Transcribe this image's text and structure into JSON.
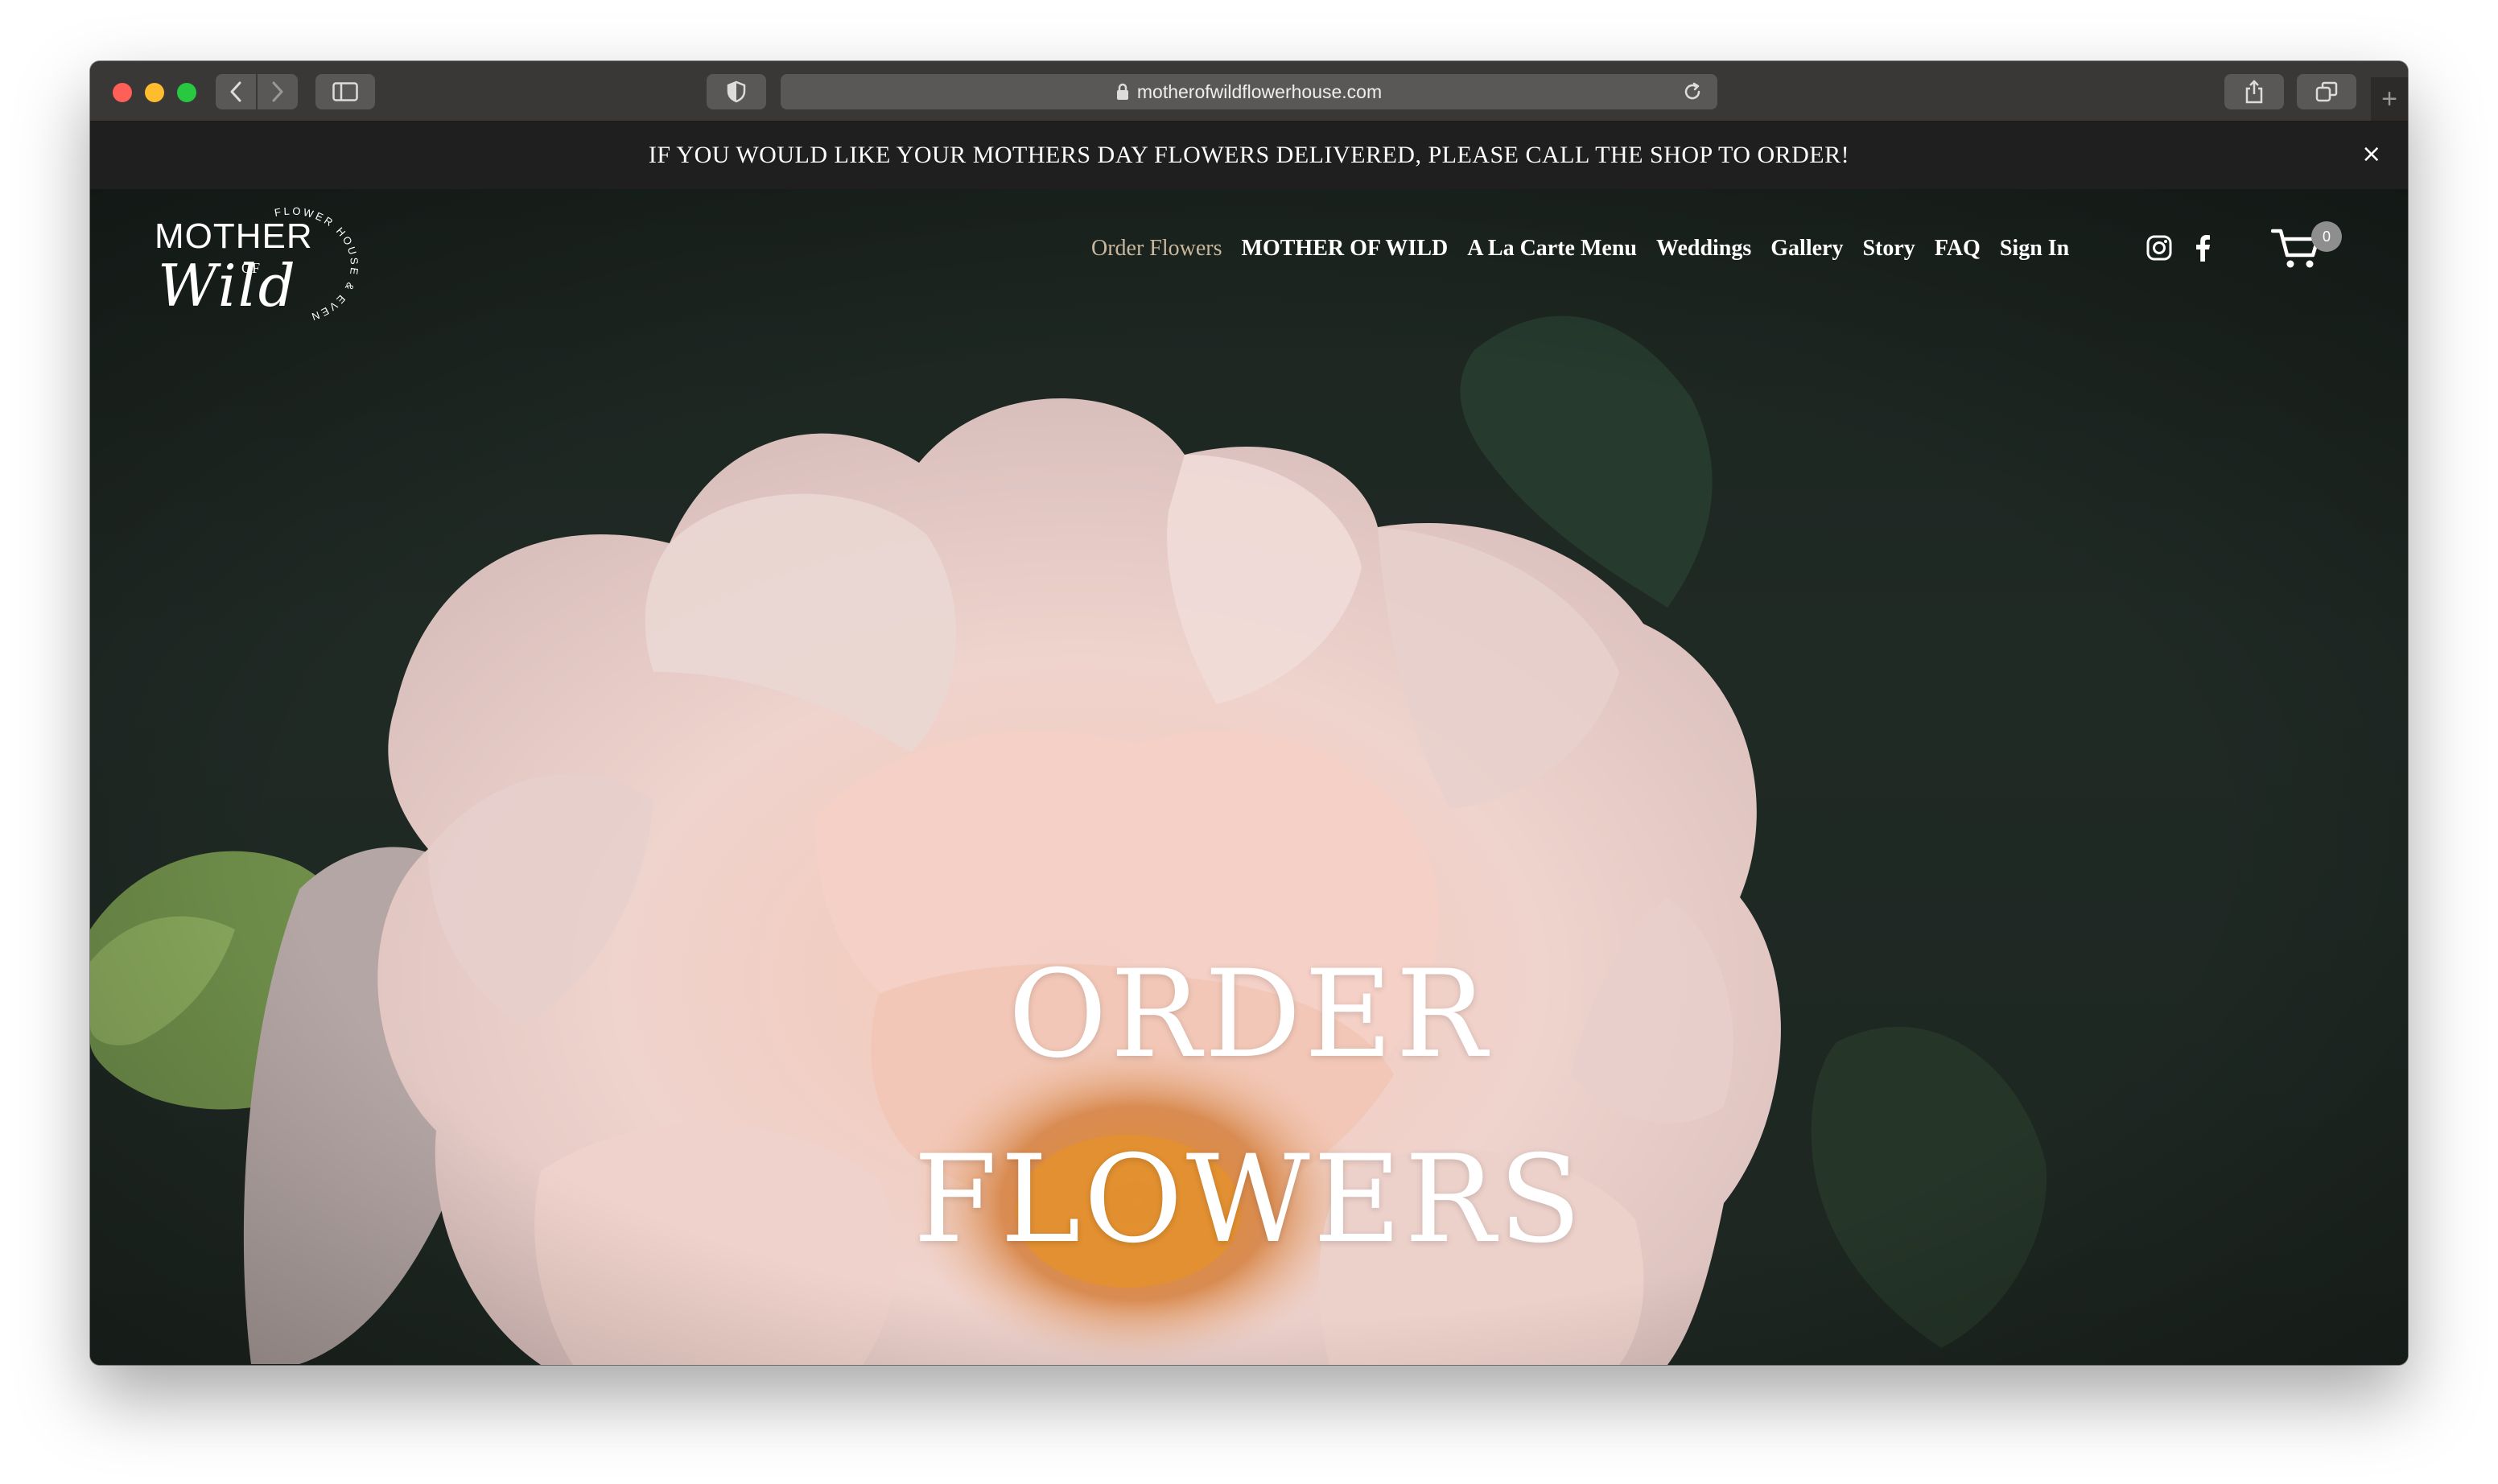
{
  "browser": {
    "url": "motherofwildflowerhouse.com",
    "new_tab_symbol": "+"
  },
  "announcement": {
    "text": "IF YOU WOULD LIKE YOUR MOTHERS DAY FLOWERS DELIVERED, PLEASE CALL THE SHOP TO ORDER!",
    "close_symbol": "×"
  },
  "logo": {
    "line1": "MOTHER",
    "line2": "OF",
    "line3": "Wild",
    "ring_text": "FLOWER HOUSE & EVENT CO."
  },
  "nav": {
    "items": [
      {
        "label": "Order Flowers",
        "active": true
      },
      {
        "label": "MOTHER OF WILD",
        "active": false
      },
      {
        "label": "A La Carte Menu",
        "active": false
      },
      {
        "label": "Weddings",
        "active": false
      },
      {
        "label": "Gallery",
        "active": false
      },
      {
        "label": "Story",
        "active": false
      },
      {
        "label": "FAQ",
        "active": false
      },
      {
        "label": "Sign In",
        "active": false
      }
    ],
    "social_icons": [
      "instagram-icon",
      "facebook-icon"
    ],
    "cart_count": "0"
  },
  "hero": {
    "title_line1": "ORDER",
    "title_line2": "FLOWERS"
  },
  "colors": {
    "toolbar": "#3a3837",
    "announcement_bg": "#1f1f1f",
    "hero_bg": "#1f2823",
    "nav_active": "#c9b89d",
    "petal": "#f2d6d0"
  }
}
